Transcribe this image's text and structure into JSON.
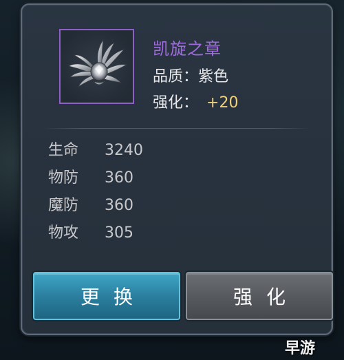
{
  "item": {
    "name": "凯旋之章",
    "icon": "winged-crest-icon",
    "quality_label": "品质：",
    "quality_value": "紫色",
    "enhance_label": "强化：",
    "enhance_value": "+20"
  },
  "stats": [
    {
      "label": "生命",
      "value": "3240"
    },
    {
      "label": "物防",
      "value": "360"
    },
    {
      "label": "魔防",
      "value": "360"
    },
    {
      "label": "物攻",
      "value": "305"
    }
  ],
  "buttons": {
    "replace_label": "更换",
    "strengthen_label": "强化"
  },
  "watermark": "早游",
  "colors": {
    "quality_purple": "#a06ae0",
    "enhance_gold": "#f2d17a",
    "replace_button": "#2b7f9f",
    "strengthen_button": "#575b60"
  }
}
